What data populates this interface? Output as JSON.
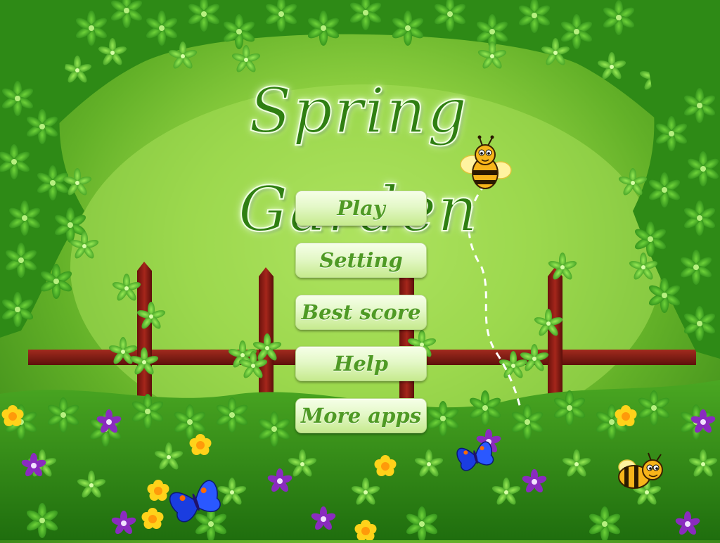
{
  "title": "Spring Garden",
  "menu": {
    "play": "Play",
    "setting": "Setting",
    "best_score": "Best score",
    "help": "Help",
    "more_apps": "More apps"
  },
  "colors": {
    "sky_light": "#b8e86a",
    "sky_mid": "#8fd041",
    "foliage_dark": "#2f7e13",
    "fence": "#8b1f17",
    "button_text": "#4f9a25",
    "title_text": "#2f7f12"
  },
  "icons": {
    "bee": "bee-icon",
    "butterfly": "butterfly-icon",
    "flower_yellow": "yellow-flower-icon",
    "flower_purple": "purple-flower-icon"
  }
}
